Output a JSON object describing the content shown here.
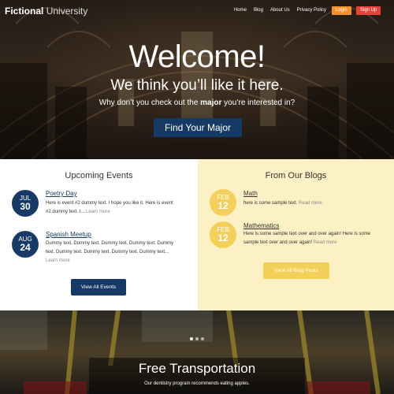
{
  "header": {
    "logo_bold": "Fictional",
    "logo_light": "University",
    "nav": [
      "Home",
      "Blog",
      "About Us",
      "Privacy Policy"
    ],
    "login": "Login",
    "signup": "Sign Up"
  },
  "hero": {
    "title": "Welcome!",
    "subtitle": "We think you’ll like it here.",
    "line_before": "Why don’t you check out the ",
    "line_bold": "major",
    "line_after": " you’re interested in?",
    "cta": "Find Your Major"
  },
  "events": {
    "heading": "Upcoming Events",
    "items": [
      {
        "month": "JUL",
        "day": "30",
        "title": "Poetry Day",
        "text_1": "Here is event #2 dummy text.  I hope you like it. Here is event",
        "text_2": "#2 dummy text.  I...",
        "more": "Learn more"
      },
      {
        "month": "AUG",
        "day": "24",
        "title": "Spanish Meetup",
        "text_1": "Dummy text. Dummy text. Dummy text. Dummy text. Dummy",
        "text_2": "text. Dummy text. Dummy text. Dummy text. Dummy text...",
        "more": "Learn more"
      }
    ],
    "button": "View All Events"
  },
  "blogs": {
    "heading": "From Our Blogs",
    "items": [
      {
        "month": "FEB",
        "day": "12",
        "title": "Math",
        "text_1": "here is some sample text.",
        "more": "Read more"
      },
      {
        "month": "FEB",
        "day": "12",
        "title": "Mathematics",
        "text_1": "Here is some sample text over and over again! Here is some",
        "text_2": "sample text over and over again!",
        "more": "Read more"
      }
    ],
    "button": "View All Blog Posts"
  },
  "slider": {
    "title": "Free Transportation",
    "text": "Our dentistry program recommends eating apples."
  },
  "colors": {
    "primary_blue": "#163a66",
    "accent_yellow": "#f4cf5a",
    "login_orange": "#f5922e",
    "signup_red": "#e8433b",
    "blog_bg": "#fbf1c4"
  }
}
